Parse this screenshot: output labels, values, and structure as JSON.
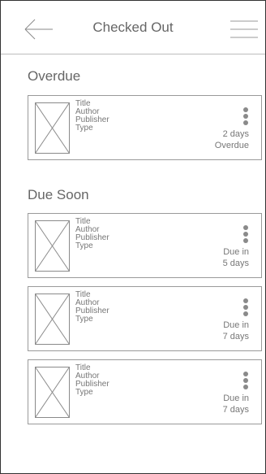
{
  "header": {
    "title": "Checked Out"
  },
  "sections": [
    {
      "label": "Overdue",
      "items": [
        {
          "title": "Title",
          "author": "Author",
          "publisher": "Publisher",
          "type": "Type",
          "status_line1": "2 days",
          "status_line2": "Overdue"
        }
      ]
    },
    {
      "label": "Due Soon",
      "items": [
        {
          "title": "Title",
          "author": "Author",
          "publisher": "Publisher",
          "type": "Type",
          "status_line1": "Due in",
          "status_line2": "5 days"
        },
        {
          "title": "Title",
          "author": "Author",
          "publisher": "Publisher",
          "type": "Type",
          "status_line1": "Due in",
          "status_line2": "7 days"
        },
        {
          "title": "Title",
          "author": "Author",
          "publisher": "Publisher",
          "type": "Type",
          "status_line1": "Due in",
          "status_line2": "7 days"
        }
      ]
    }
  ],
  "icons": {
    "back": "arrow-left-icon",
    "menu": "hamburger-menu-icon",
    "thumbnail": "image-placeholder-icon",
    "more": "kebab-menu-icon"
  },
  "colors": {
    "frame": "#333333",
    "divider": "#bdbdbd",
    "card_border": "#9a9a9a",
    "text": "#666666"
  }
}
